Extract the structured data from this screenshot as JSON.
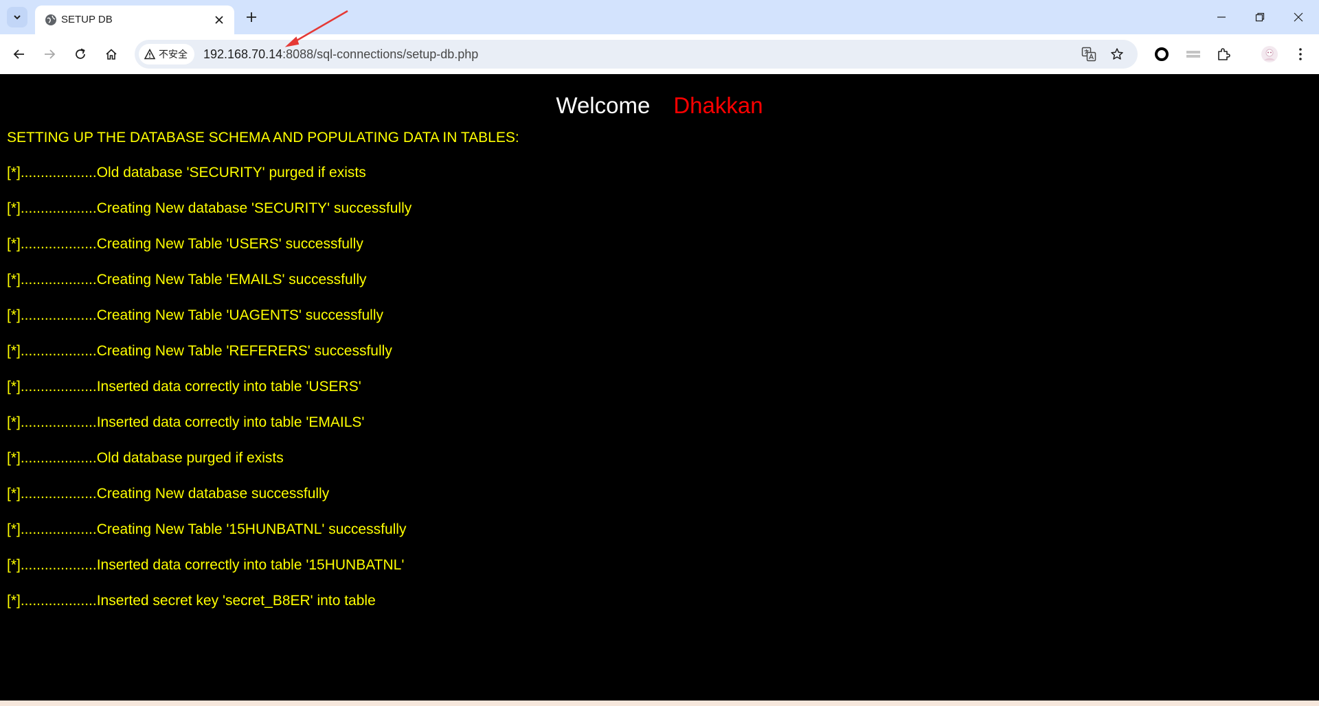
{
  "tab": {
    "title": "SETUP DB"
  },
  "address_bar": {
    "security_label": "不安全",
    "url_host": "192.168.70.14",
    "url_rest": ":8088/sql-connections/setup-db.php"
  },
  "icons": {
    "tab_search": "chevron-down-icon",
    "favicon": "globe-icon",
    "tab_close": "close-icon",
    "new_tab": "plus-icon",
    "minimize": "minimize-icon",
    "restore": "restore-icon",
    "close_window": "close-icon",
    "back": "arrow-left-icon",
    "forward": "arrow-right-icon",
    "reload": "reload-icon",
    "home": "home-icon",
    "warning": "warning-icon",
    "translate": "translate-icon",
    "bookmark": "star-icon",
    "extension_1": "circle-icon",
    "extension_2": "stack-icon",
    "extensions": "puzzle-icon",
    "profile": "avatar-icon",
    "menu": "kebab-menu-icon",
    "annotation": "red-arrow-icon"
  },
  "colors": {
    "page_background": "#000000",
    "welcome_text": "#ffffff",
    "username_text": "#ff0000",
    "log_text": "#ffff00",
    "annotation_arrow": "#e53935"
  },
  "page": {
    "welcome_word": "Welcome",
    "user_name": "Dhakkan",
    "heading": "SETTING UP THE DATABASE SCHEMA AND POPULATING DATA IN TABLES:",
    "log_lines": [
      "[*]...................Old database 'SECURITY' purged if exists",
      "[*]...................Creating New database 'SECURITY' successfully",
      "[*]...................Creating New Table 'USERS' successfully",
      "[*]...................Creating New Table 'EMAILS' successfully",
      "[*]...................Creating New Table 'UAGENTS' successfully",
      "[*]...................Creating New Table 'REFERERS' successfully",
      "[*]...................Inserted data correctly into table 'USERS'",
      "[*]...................Inserted data correctly into table 'EMAILS'",
      "[*]...................Old database purged if exists",
      "[*]...................Creating New database successfully",
      "[*]...................Creating New Table '15HUNBATNL' successfully",
      "[*]...................Inserted data correctly into table '15HUNBATNL'",
      "[*]...................Inserted secret key 'secret_B8ER' into table"
    ]
  }
}
